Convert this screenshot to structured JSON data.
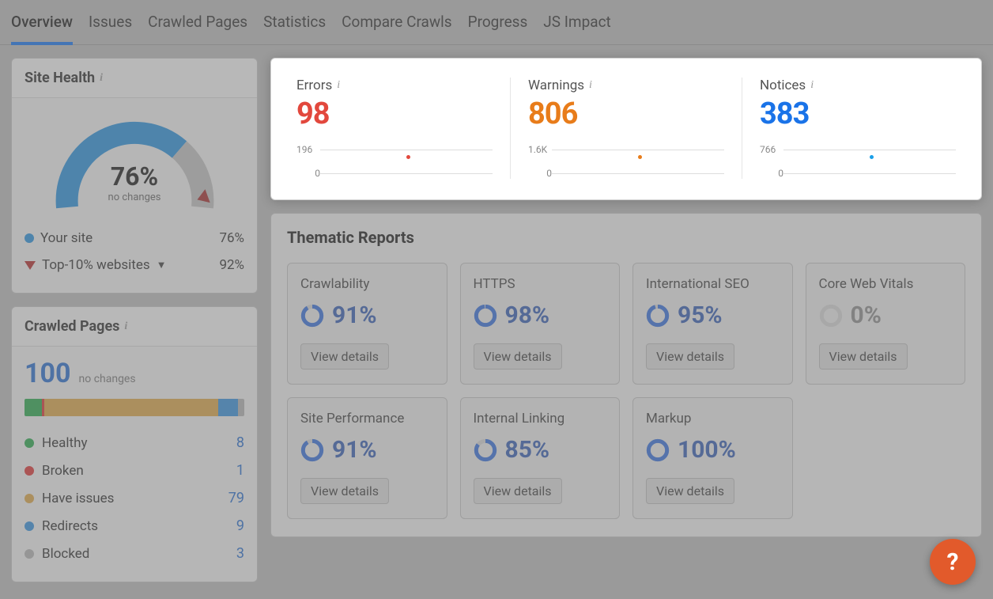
{
  "tabs": [
    "Overview",
    "Issues",
    "Crawled Pages",
    "Statistics",
    "Compare Crawls",
    "Progress",
    "JS Impact"
  ],
  "active_tab": 0,
  "site_health": {
    "title": "Site Health",
    "value": "76%",
    "subtext": "no changes",
    "legend": [
      {
        "label": "Your site",
        "value": "76%",
        "color": "#2d8fd6",
        "type": "dot"
      },
      {
        "label": "Top-10% websites",
        "value": "92%",
        "color": "#b03030",
        "type": "triangle",
        "expandable": true
      }
    ]
  },
  "crawled": {
    "title": "Crawled Pages",
    "count": "100",
    "subtext": "no changes",
    "breakdown": [
      {
        "label": "Healthy",
        "count": 8,
        "color": "#2ea44f"
      },
      {
        "label": "Broken",
        "count": 1,
        "color": "#d63a3a"
      },
      {
        "label": "Have issues",
        "count": 79,
        "color": "#d6a24a"
      },
      {
        "label": "Redirects",
        "count": 9,
        "color": "#3a8fd6"
      },
      {
        "label": "Blocked",
        "count": 3,
        "color": "#b0b0b0"
      }
    ]
  },
  "stats": {
    "errors": {
      "label": "Errors",
      "value": "98",
      "axis_top": "196",
      "axis_bottom": "0",
      "dot_color": "#e2483d"
    },
    "warnings": {
      "label": "Warnings",
      "value": "806",
      "axis_top": "1.6K",
      "axis_bottom": "0",
      "dot_color": "#e87c1a"
    },
    "notices": {
      "label": "Notices",
      "value": "383",
      "axis_top": "766",
      "axis_bottom": "0",
      "dot_color": "#1a9fe8"
    }
  },
  "thematic": {
    "heading": "Thematic Reports",
    "view_label": "View details",
    "reports": [
      {
        "title": "Crawlability",
        "pct": "91%",
        "fill": 91,
        "color": "#3a6fd6"
      },
      {
        "title": "HTTPS",
        "pct": "98%",
        "fill": 98,
        "color": "#3a6fd6"
      },
      {
        "title": "International SEO",
        "pct": "95%",
        "fill": 95,
        "color": "#3a6fd6"
      },
      {
        "title": "Core Web Vitals",
        "pct": "0%",
        "fill": 0,
        "color": "#bdbdbd"
      },
      {
        "title": "Site Performance",
        "pct": "91%",
        "fill": 91,
        "color": "#3a6fd6"
      },
      {
        "title": "Internal Linking",
        "pct": "85%",
        "fill": 85,
        "color": "#3a6fd6"
      },
      {
        "title": "Markup",
        "pct": "100%",
        "fill": 100,
        "color": "#3a6fd6"
      }
    ]
  },
  "help_label": "?"
}
